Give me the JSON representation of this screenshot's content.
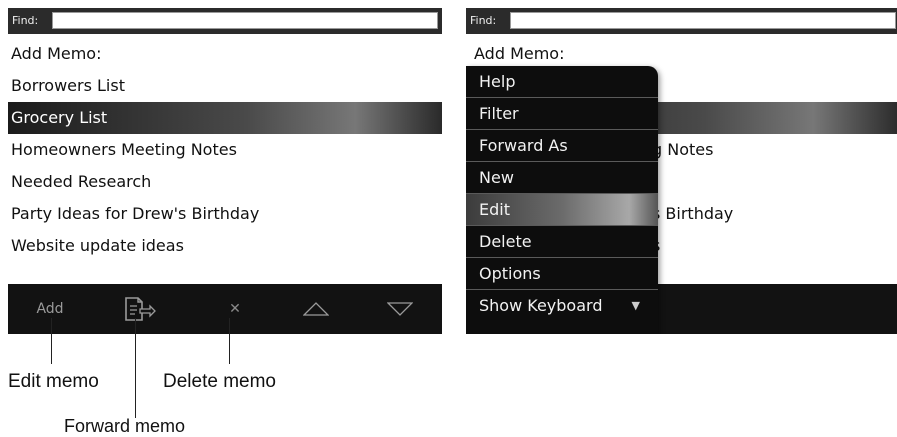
{
  "left_screen": {
    "find_label": "Find:",
    "find_value": "",
    "items": [
      {
        "label": "Add Memo:"
      },
      {
        "label": "Borrowers List"
      },
      {
        "label": "Grocery List",
        "selected": true
      },
      {
        "label": "Homeowners Meeting Notes"
      },
      {
        "label": "Needed Research"
      },
      {
        "label": "Party Ideas for Drew's Birthday"
      },
      {
        "label": "Website update ideas"
      }
    ],
    "toolbar": {
      "add_label": "Add",
      "forward_icon": "forward-memo-icon",
      "delete_glyph": "✕",
      "up_icon": "triangle-up-icon",
      "down_icon": "triangle-down-icon"
    }
  },
  "right_screen": {
    "find_label": "Find:",
    "find_value": "",
    "visible_list_fragments": {
      "item0": "Add Memo:",
      "item3": "g Notes",
      "item5": "s Birthday",
      "item6": "s"
    },
    "menu": {
      "items": [
        {
          "label": "Help"
        },
        {
          "label": "Filter"
        },
        {
          "label": "Forward As"
        },
        {
          "label": "New"
        },
        {
          "label": "Edit",
          "selected": true
        },
        {
          "label": "Delete"
        },
        {
          "label": "Options"
        },
        {
          "label": "Show Keyboard"
        }
      ],
      "more_arrow": "▼"
    }
  },
  "callouts": {
    "edit": "Edit memo",
    "delete": "Delete memo",
    "forward": "Forward memo"
  },
  "colors": {
    "toolbar_bg": "#121212",
    "selection_bg": "#3a3a3a",
    "menu_bg": "#0d0d0d"
  }
}
